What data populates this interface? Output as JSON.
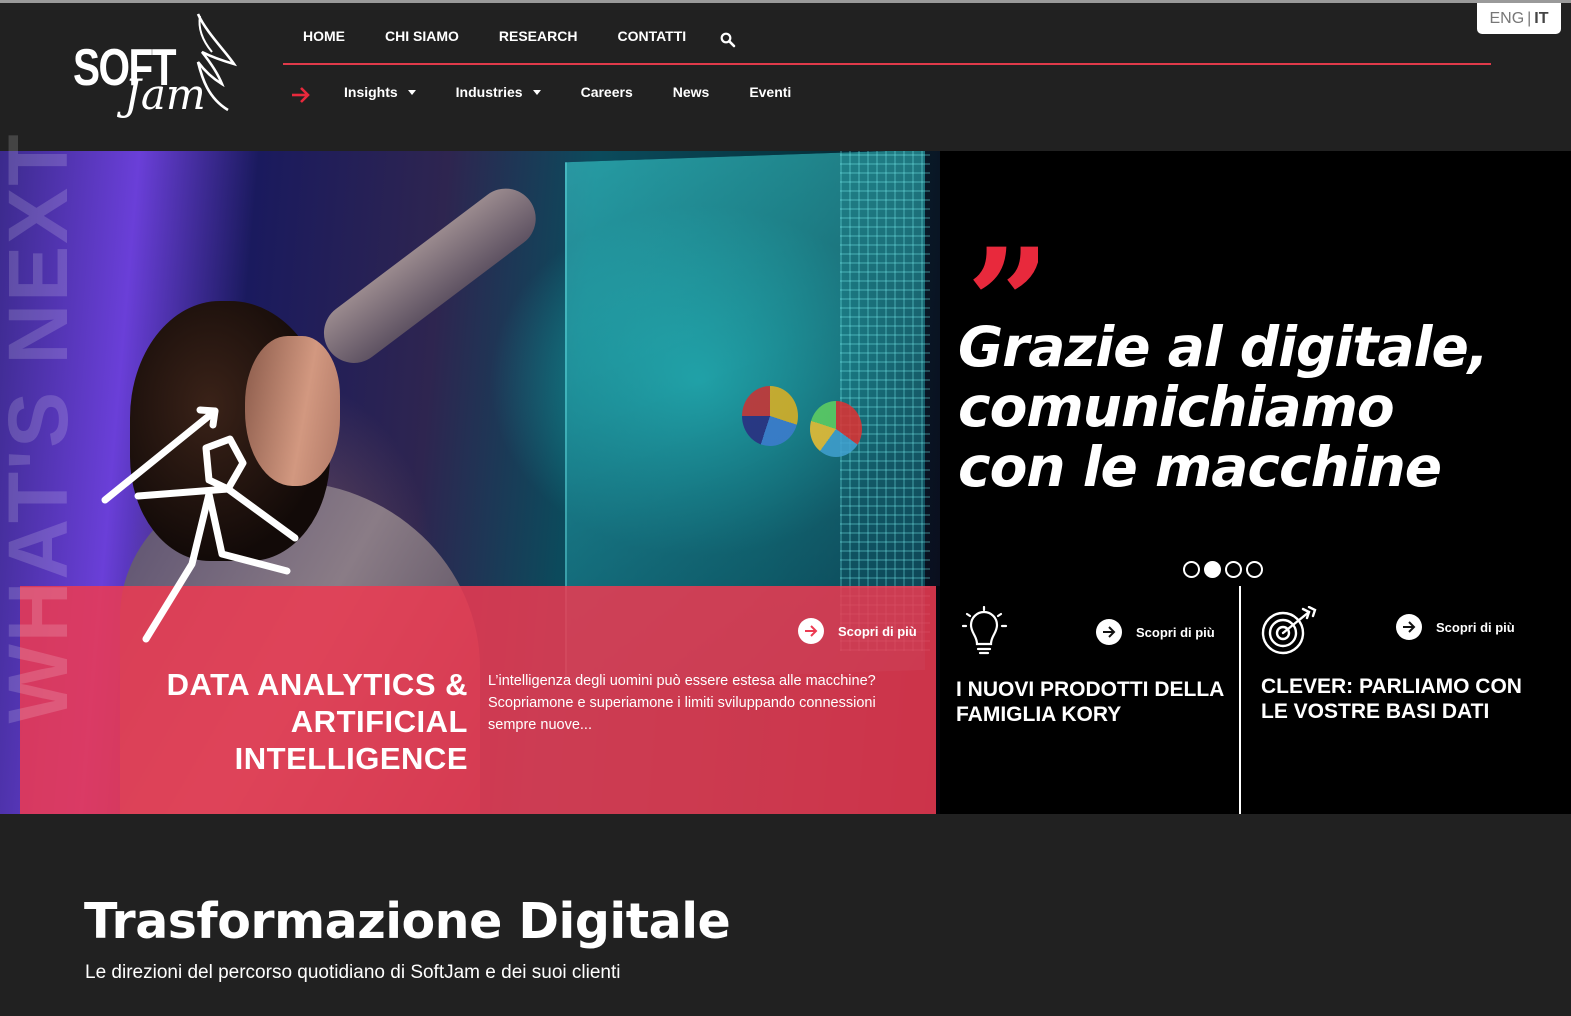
{
  "side_text": "WHAT'S NEXT",
  "logo": {
    "word1": "SOFT",
    "word2": "Jam"
  },
  "nav": {
    "primary": [
      "HOME",
      "CHI SIAMO",
      "RESEARCH",
      "CONTATTI"
    ],
    "secondary": [
      {
        "label": "Insights",
        "dropdown": true
      },
      {
        "label": "Industries",
        "dropdown": true
      },
      {
        "label": "Careers",
        "dropdown": false
      },
      {
        "label": "News",
        "dropdown": false
      },
      {
        "label": "Eventi",
        "dropdown": false
      }
    ]
  },
  "lang": {
    "eng": "ENG",
    "sep": "|",
    "it": "IT"
  },
  "hero": {
    "quote_mark": "”",
    "quote": "Grazie al digitale, comunichiamo con le macchine",
    "slides_total": 4,
    "active_slide": 2
  },
  "cards": {
    "featured": {
      "title": "DATA ANALYTICS & ARTIFICIAL INTELLIGENCE",
      "description": "L’intelligenza degli uomini può essere estesa alle macchine? Scopriamone e superiamone i limiti sviluppando connessioni sempre nuove...",
      "more": "Scopri di più"
    },
    "kory": {
      "title": "I NUOVI PRODOTTI DELLA FAMIGLIA KORY",
      "more": "Scopri di più",
      "icon": "lightbulb-icon"
    },
    "clever": {
      "title": "CLEVER: PARLIAMO CON LE VOSTRE BASI DATI",
      "more": "Scopri di più",
      "icon": "target-icon"
    }
  },
  "section": {
    "title": "Trasformazione Digitale",
    "subtitle": "Le direzioni del percorso quotidiano di SoftJam e dei suoi clienti"
  },
  "colors": {
    "accent": "#e8293c",
    "card": "#ec3a52",
    "background": "#212121"
  }
}
